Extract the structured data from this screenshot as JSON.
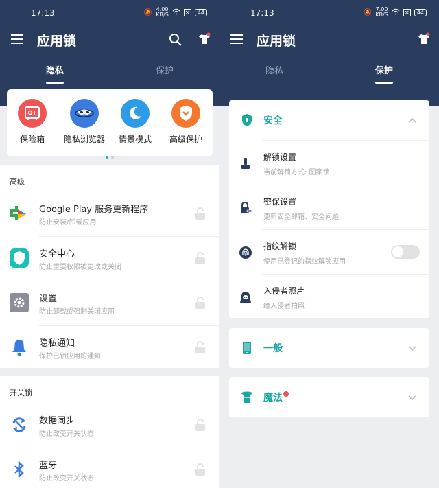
{
  "status": {
    "time": "17:13",
    "battery": "44"
  },
  "left": {
    "status_speed": "4.00",
    "status_unit": "KB/S",
    "title": "应用锁",
    "tabs": [
      {
        "label": "隐私"
      },
      {
        "label": "保护"
      }
    ],
    "features": [
      {
        "label": "保险箱"
      },
      {
        "label": "隐私浏览器"
      },
      {
        "label": "情景模式"
      },
      {
        "label": "高级保护"
      }
    ],
    "advanced": {
      "title": "高级",
      "items": [
        {
          "name": "Google Play 服务更新程序",
          "desc": "防止安装/卸载应用"
        },
        {
          "name": "安全中心",
          "desc": "防止重要权限被更改或关闭"
        },
        {
          "name": "设置",
          "desc": "防止卸载或强制关闭应用"
        },
        {
          "name": "隐私通知",
          "desc": "保护已锁应用的通知"
        }
      ]
    },
    "switch_lock": {
      "title": "开关锁",
      "items": [
        {
          "name": "数据同步",
          "desc": "防止改变开关状态"
        },
        {
          "name": "蓝牙",
          "desc": "防止改变开关状态"
        }
      ]
    }
  },
  "right": {
    "status_speed": "7.00",
    "status_unit": "KB/S",
    "title": "应用锁",
    "tabs": [
      {
        "label": "隐私"
      },
      {
        "label": "保护"
      }
    ],
    "security": {
      "title": "安全",
      "items": [
        {
          "name": "解锁设置",
          "desc": "当前解锁方式: 图案锁"
        },
        {
          "name": "密保设置",
          "desc": "更新安全邮箱、安全问题"
        },
        {
          "name": "指纹解锁",
          "desc": "使用已登记的指纹解锁应用"
        },
        {
          "name": "入侵者照片",
          "desc": "给入侵者拍照"
        }
      ]
    },
    "general": {
      "title": "一般"
    },
    "magic": {
      "title": "魔法"
    }
  },
  "colors": {
    "navy": "#2b3d5f",
    "teal": "#1aa6a1",
    "red": "#e85656"
  }
}
